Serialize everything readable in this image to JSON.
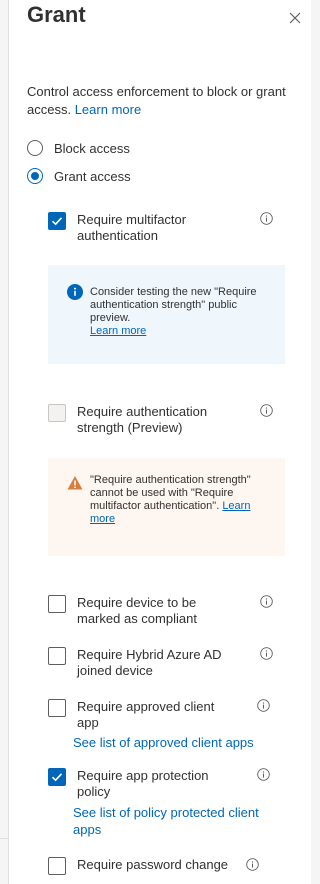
{
  "panel": {
    "title": "Grant",
    "description": "Control access enforcement to block or grant access.",
    "learn_more": "Learn more"
  },
  "access": {
    "options": [
      {
        "label": "Block access",
        "selected": false
      },
      {
        "label": "Grant access",
        "selected": true
      }
    ]
  },
  "controls": {
    "mfa": {
      "label": "Require multifactor authentication",
      "checked": true
    },
    "mfa_info": {
      "text": "Consider testing the new \"Require authentication strength\" public preview.",
      "link": "Learn more"
    },
    "auth_strength": {
      "label": "Require authentication strength (Preview)",
      "checked": false,
      "disabled": true
    },
    "auth_strength_warning": {
      "text": "\"Require authentication strength\" cannot be used with \"Require multifactor authentication\".",
      "link": "Learn more"
    },
    "compliant": {
      "label": "Require device to be marked as compliant",
      "checked": false
    },
    "hybrid": {
      "label": "Require Hybrid Azure AD joined device",
      "checked": false
    },
    "approved_app": {
      "label": "Require approved client app",
      "checked": false,
      "link": "See list of approved client apps"
    },
    "app_protection": {
      "label": "Require app protection policy",
      "checked": true,
      "link": "See list of policy protected client apps"
    },
    "password_change": {
      "label": "Require password change",
      "checked": false
    }
  },
  "colors": {
    "accent": "#0067b8",
    "info_bg": "#eff6fc",
    "warning_bg": "#fdf6f1",
    "warning_icon": "#d67f3c"
  },
  "icons": {
    "close": "close-icon",
    "info": "info-icon",
    "info_filled": "info-filled-icon",
    "warning": "warning-icon",
    "check": "checkmark-icon"
  }
}
